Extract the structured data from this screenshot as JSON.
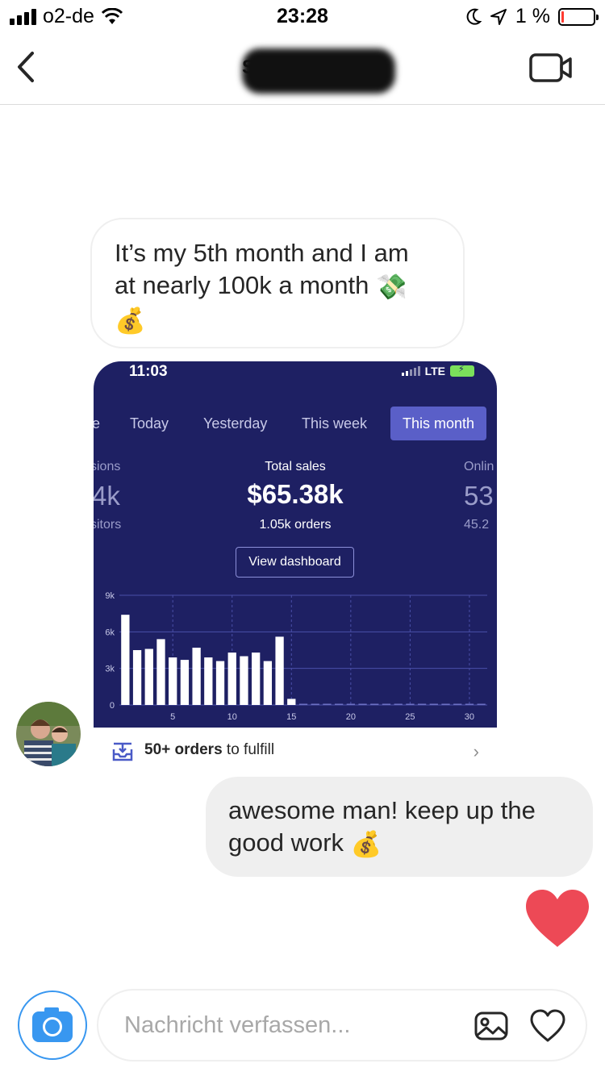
{
  "status_bar": {
    "carrier": "o2-de",
    "time": "23:28",
    "battery_pct": "1 %"
  },
  "header": {
    "contact_name": "S",
    "back_icon": "chevron-left-icon",
    "video_icon": "video-camera-icon"
  },
  "messages": [
    {
      "direction": "incoming",
      "line1": "It’s my 5th month and I am",
      "line2": "at nearly 100k a month",
      "emoji_a": "💸",
      "emoji_b": "💰"
    },
    {
      "direction": "outgoing",
      "line1": "awesome man! keep up the",
      "line2": "good work",
      "emoji": "💰"
    }
  ],
  "attached_screenshot": {
    "time": "11:03",
    "network": "LTE",
    "tabs": [
      "e",
      "Today",
      "Yesterday",
      "This week",
      "This month"
    ],
    "active_tab": "This month",
    "metrics": {
      "left_label": "sions",
      "left_value": "4k",
      "left_sub": "sitors",
      "center_label": "Total sales",
      "center_value": "$65.38k",
      "center_sub": "1.05k orders",
      "right_label": "Onlin",
      "right_value": "53",
      "right_sub": "45.2"
    },
    "view_dashboard_label": "View dashboard",
    "fulfill": {
      "count": "50+ orders",
      "text": " to fulfill",
      "chevron": "›"
    }
  },
  "chart_data": {
    "type": "bar",
    "x": [
      1,
      2,
      3,
      4,
      5,
      6,
      7,
      8,
      9,
      10,
      11,
      12,
      13,
      14,
      15,
      16,
      17,
      18,
      19,
      20,
      21,
      22,
      23,
      24,
      25,
      26,
      27,
      28,
      29,
      30,
      31
    ],
    "values": [
      7400,
      4500,
      4600,
      5400,
      3900,
      3700,
      4700,
      3900,
      3600,
      4300,
      4000,
      4300,
      3600,
      5600,
      500,
      100,
      100,
      100,
      100,
      100,
      100,
      100,
      100,
      100,
      100,
      100,
      100,
      100,
      100,
      100,
      100
    ],
    "x_ticks": [
      "5",
      "10",
      "15",
      "20",
      "25",
      "30"
    ],
    "y_ticks": [
      "0",
      "3k",
      "6k",
      "9k"
    ],
    "ylim": [
      0,
      9000
    ],
    "grid": true
  },
  "composer": {
    "placeholder": "Nachricht verfassen...",
    "camera_icon": "camera-icon",
    "gallery_icon": "image-icon",
    "like_icon": "heart-outline-icon"
  },
  "reaction": {
    "icon": "heart-icon",
    "color": "#ed4956"
  },
  "colors": {
    "accent": "#3897f0",
    "dashboard_bg": "#1e2063",
    "active_tab": "#5a5fc8"
  }
}
